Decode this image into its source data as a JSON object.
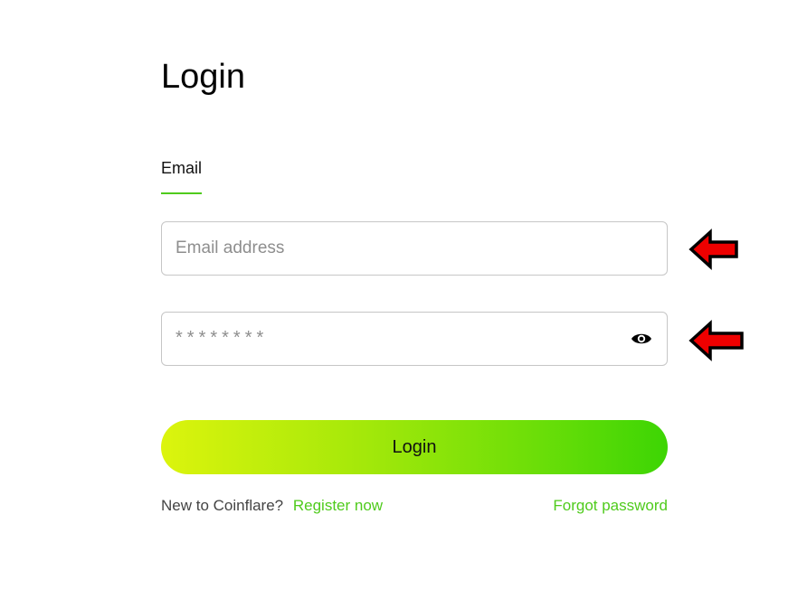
{
  "page": {
    "title": "Login"
  },
  "tabs": [
    {
      "label": "Email",
      "active": true
    }
  ],
  "form": {
    "email": {
      "value": "",
      "placeholder": "Email address"
    },
    "password": {
      "value": "",
      "placeholder": "********"
    },
    "login_label": "Login"
  },
  "footer": {
    "new_to_text": "New to Coinflare?",
    "register_label": "Register now",
    "forgot_label": "Forgot password"
  },
  "icons": {
    "password_toggle": "eye-icon",
    "annotation": "red-arrow-left-icon"
  },
  "colors": {
    "accent": "#4fcb1c",
    "button_gradient_start": "#dcf40d",
    "button_gradient_end": "#3dd504",
    "annotation_arrow": "#ee0000"
  }
}
